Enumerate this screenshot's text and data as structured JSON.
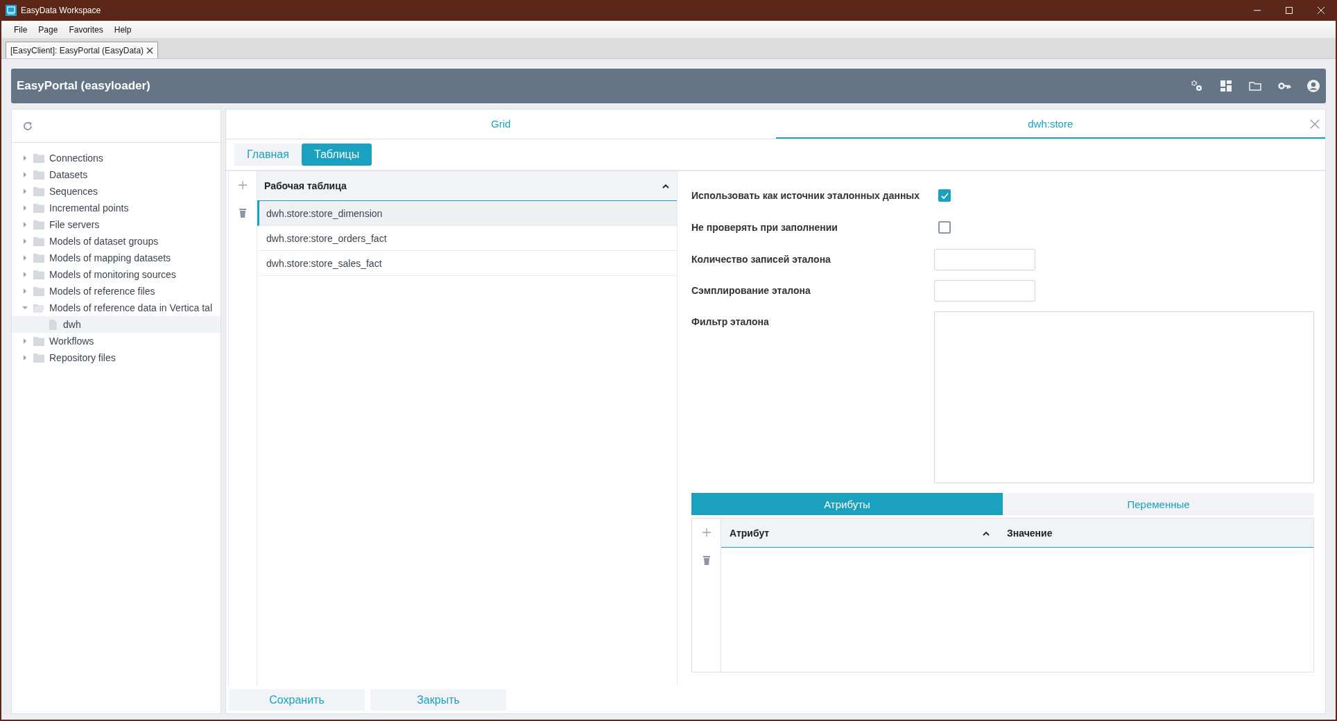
{
  "window": {
    "title": "EasyData Workspace"
  },
  "menu": [
    "File",
    "Page",
    "Favorites",
    "Help"
  ],
  "doc_tabs": [
    {
      "label": "[EasyClient]: EasyPortal (EasyData)",
      "selected": true
    }
  ],
  "header": {
    "title": "EasyPortal (easyloader)"
  },
  "tree": [
    {
      "kind": "folder",
      "label": "Connections",
      "expanded": false,
      "selected": false
    },
    {
      "kind": "folder",
      "label": "Datasets",
      "expanded": false,
      "selected": false
    },
    {
      "kind": "folder",
      "label": "Sequences",
      "expanded": false,
      "selected": false
    },
    {
      "kind": "folder",
      "label": "Incremental points",
      "expanded": false,
      "selected": false
    },
    {
      "kind": "folder",
      "label": "File servers",
      "expanded": false,
      "selected": false
    },
    {
      "kind": "folder",
      "label": "Models of dataset groups",
      "expanded": false,
      "selected": false
    },
    {
      "kind": "folder",
      "label": "Models of mapping datasets",
      "expanded": false,
      "selected": false
    },
    {
      "kind": "folder",
      "label": "Models of monitoring sources",
      "expanded": false,
      "selected": false
    },
    {
      "kind": "folder",
      "label": "Models of reference files",
      "expanded": false,
      "selected": false
    },
    {
      "kind": "folder",
      "label": "Models of reference data in Vertica tal",
      "expanded": true,
      "selected": false,
      "children": [
        {
          "kind": "file",
          "label": "dwh",
          "selected": true
        }
      ]
    },
    {
      "kind": "folder",
      "label": "Workflows",
      "expanded": false,
      "selected": false
    },
    {
      "kind": "folder",
      "label": "Repository files",
      "expanded": false,
      "selected": false
    }
  ],
  "page_tabs": [
    {
      "label": "Grid",
      "selected": false,
      "closable": false
    },
    {
      "label": "dwh:store",
      "selected": true,
      "closable": true
    }
  ],
  "sub_tabs": [
    {
      "label": "Главная",
      "selected": false
    },
    {
      "label": "Таблицы",
      "selected": true
    }
  ],
  "tables": {
    "column": "Рабочая таблица",
    "rows": [
      {
        "name": "dwh.store:store_dimension",
        "selected": true
      },
      {
        "name": "dwh.store:store_orders_fact",
        "selected": false
      },
      {
        "name": "dwh.store:store_sales_fact",
        "selected": false
      }
    ]
  },
  "form": {
    "fields": [
      {
        "kind": "checkbox",
        "label": "Использовать как источник эталонных данных",
        "checked": true
      },
      {
        "kind": "checkbox",
        "label": "Не проверять при заполнении",
        "checked": false
      },
      {
        "kind": "input",
        "label": "Количество записей эталона"
      },
      {
        "kind": "input",
        "label": "Сэмплирование эталона"
      },
      {
        "kind": "textarea",
        "label": "Фильтр эталона"
      }
    ]
  },
  "attr_tabs": [
    {
      "label": "Атрибуты",
      "selected": true
    },
    {
      "label": "Переменные",
      "selected": false
    }
  ],
  "attr_table": {
    "columns": [
      "Атрибут",
      "Значение"
    ]
  },
  "buttons": [
    "Сохранить",
    "Закрыть"
  ]
}
